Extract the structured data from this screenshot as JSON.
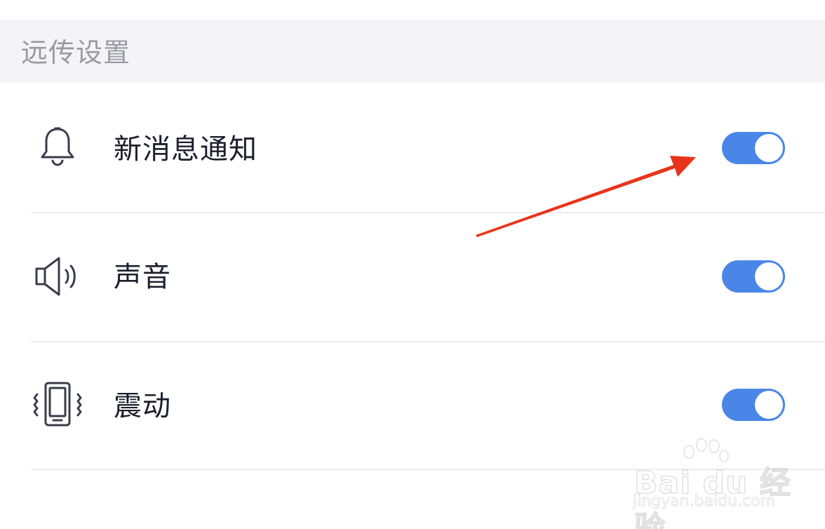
{
  "section": {
    "title": "远传设置"
  },
  "settings": [
    {
      "label": "新消息通知",
      "icon": "bell-icon",
      "enabled": true
    },
    {
      "label": "声音",
      "icon": "speaker-icon",
      "enabled": true
    },
    {
      "label": "震动",
      "icon": "vibrate-icon",
      "enabled": true
    }
  ],
  "colors": {
    "toggle_on": "#4a86e8",
    "header_bg": "#f4f4f6",
    "annotation_arrow": "#e8341c"
  },
  "watermark": {
    "brand": "Bai du 经验",
    "url": "jingyan.baidu.com"
  }
}
